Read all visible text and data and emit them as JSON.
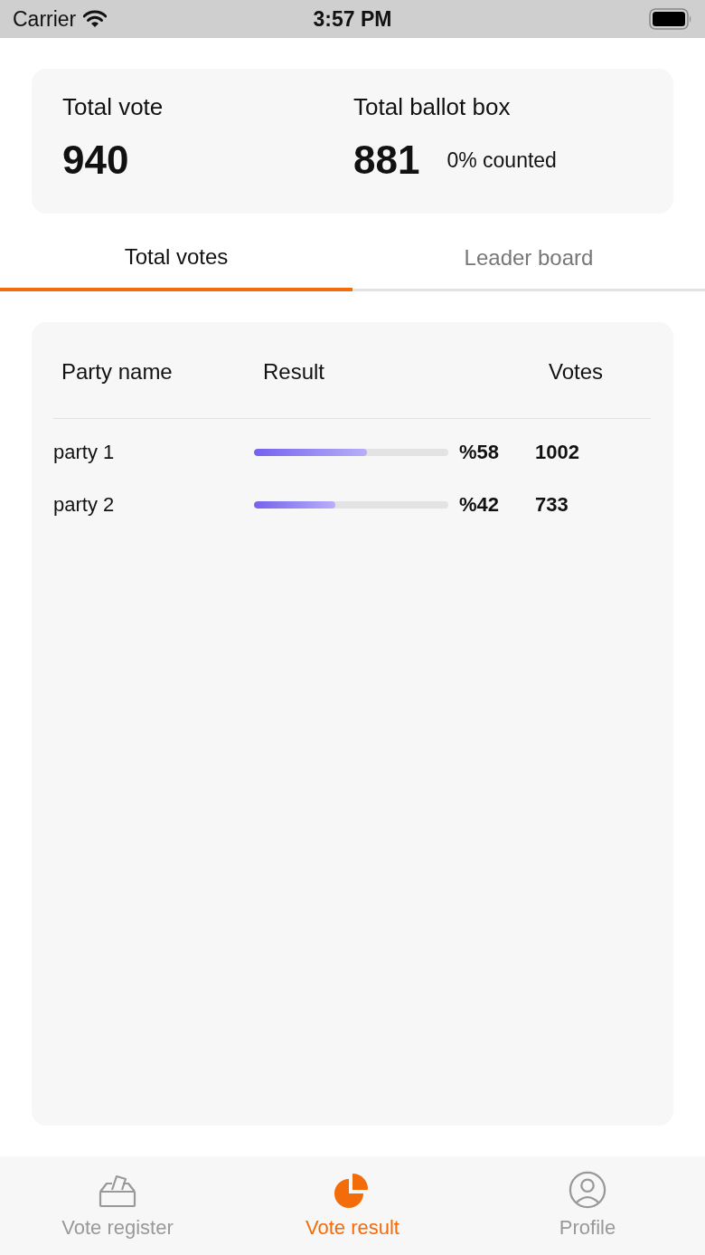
{
  "status_bar": {
    "carrier": "Carrier",
    "time": "3:57 PM"
  },
  "summary": [
    {
      "label": "Total vote",
      "value": "940"
    },
    {
      "label": "Total ballot box",
      "value": "881",
      "note": "0% counted"
    }
  ],
  "tabs": [
    {
      "label": "Total votes",
      "selected": true
    },
    {
      "label": "Leader board",
      "selected": false
    }
  ],
  "table": {
    "columns": [
      "Party name",
      "Result",
      "Votes"
    ],
    "rows": [
      {
        "party": "party 1",
        "level": 0.58,
        "percent": "%58",
        "votes": "1002"
      },
      {
        "party": "party 2",
        "level": 0.42,
        "percent": "%42",
        "votes": "733"
      }
    ]
  },
  "bottom_nav": [
    {
      "kind": "ballot",
      "label": "Vote register",
      "selected": false
    },
    {
      "kind": "pie",
      "label": "Vote result",
      "selected": true
    },
    {
      "kind": "person",
      "label": "Profile",
      "selected": false
    }
  ]
}
